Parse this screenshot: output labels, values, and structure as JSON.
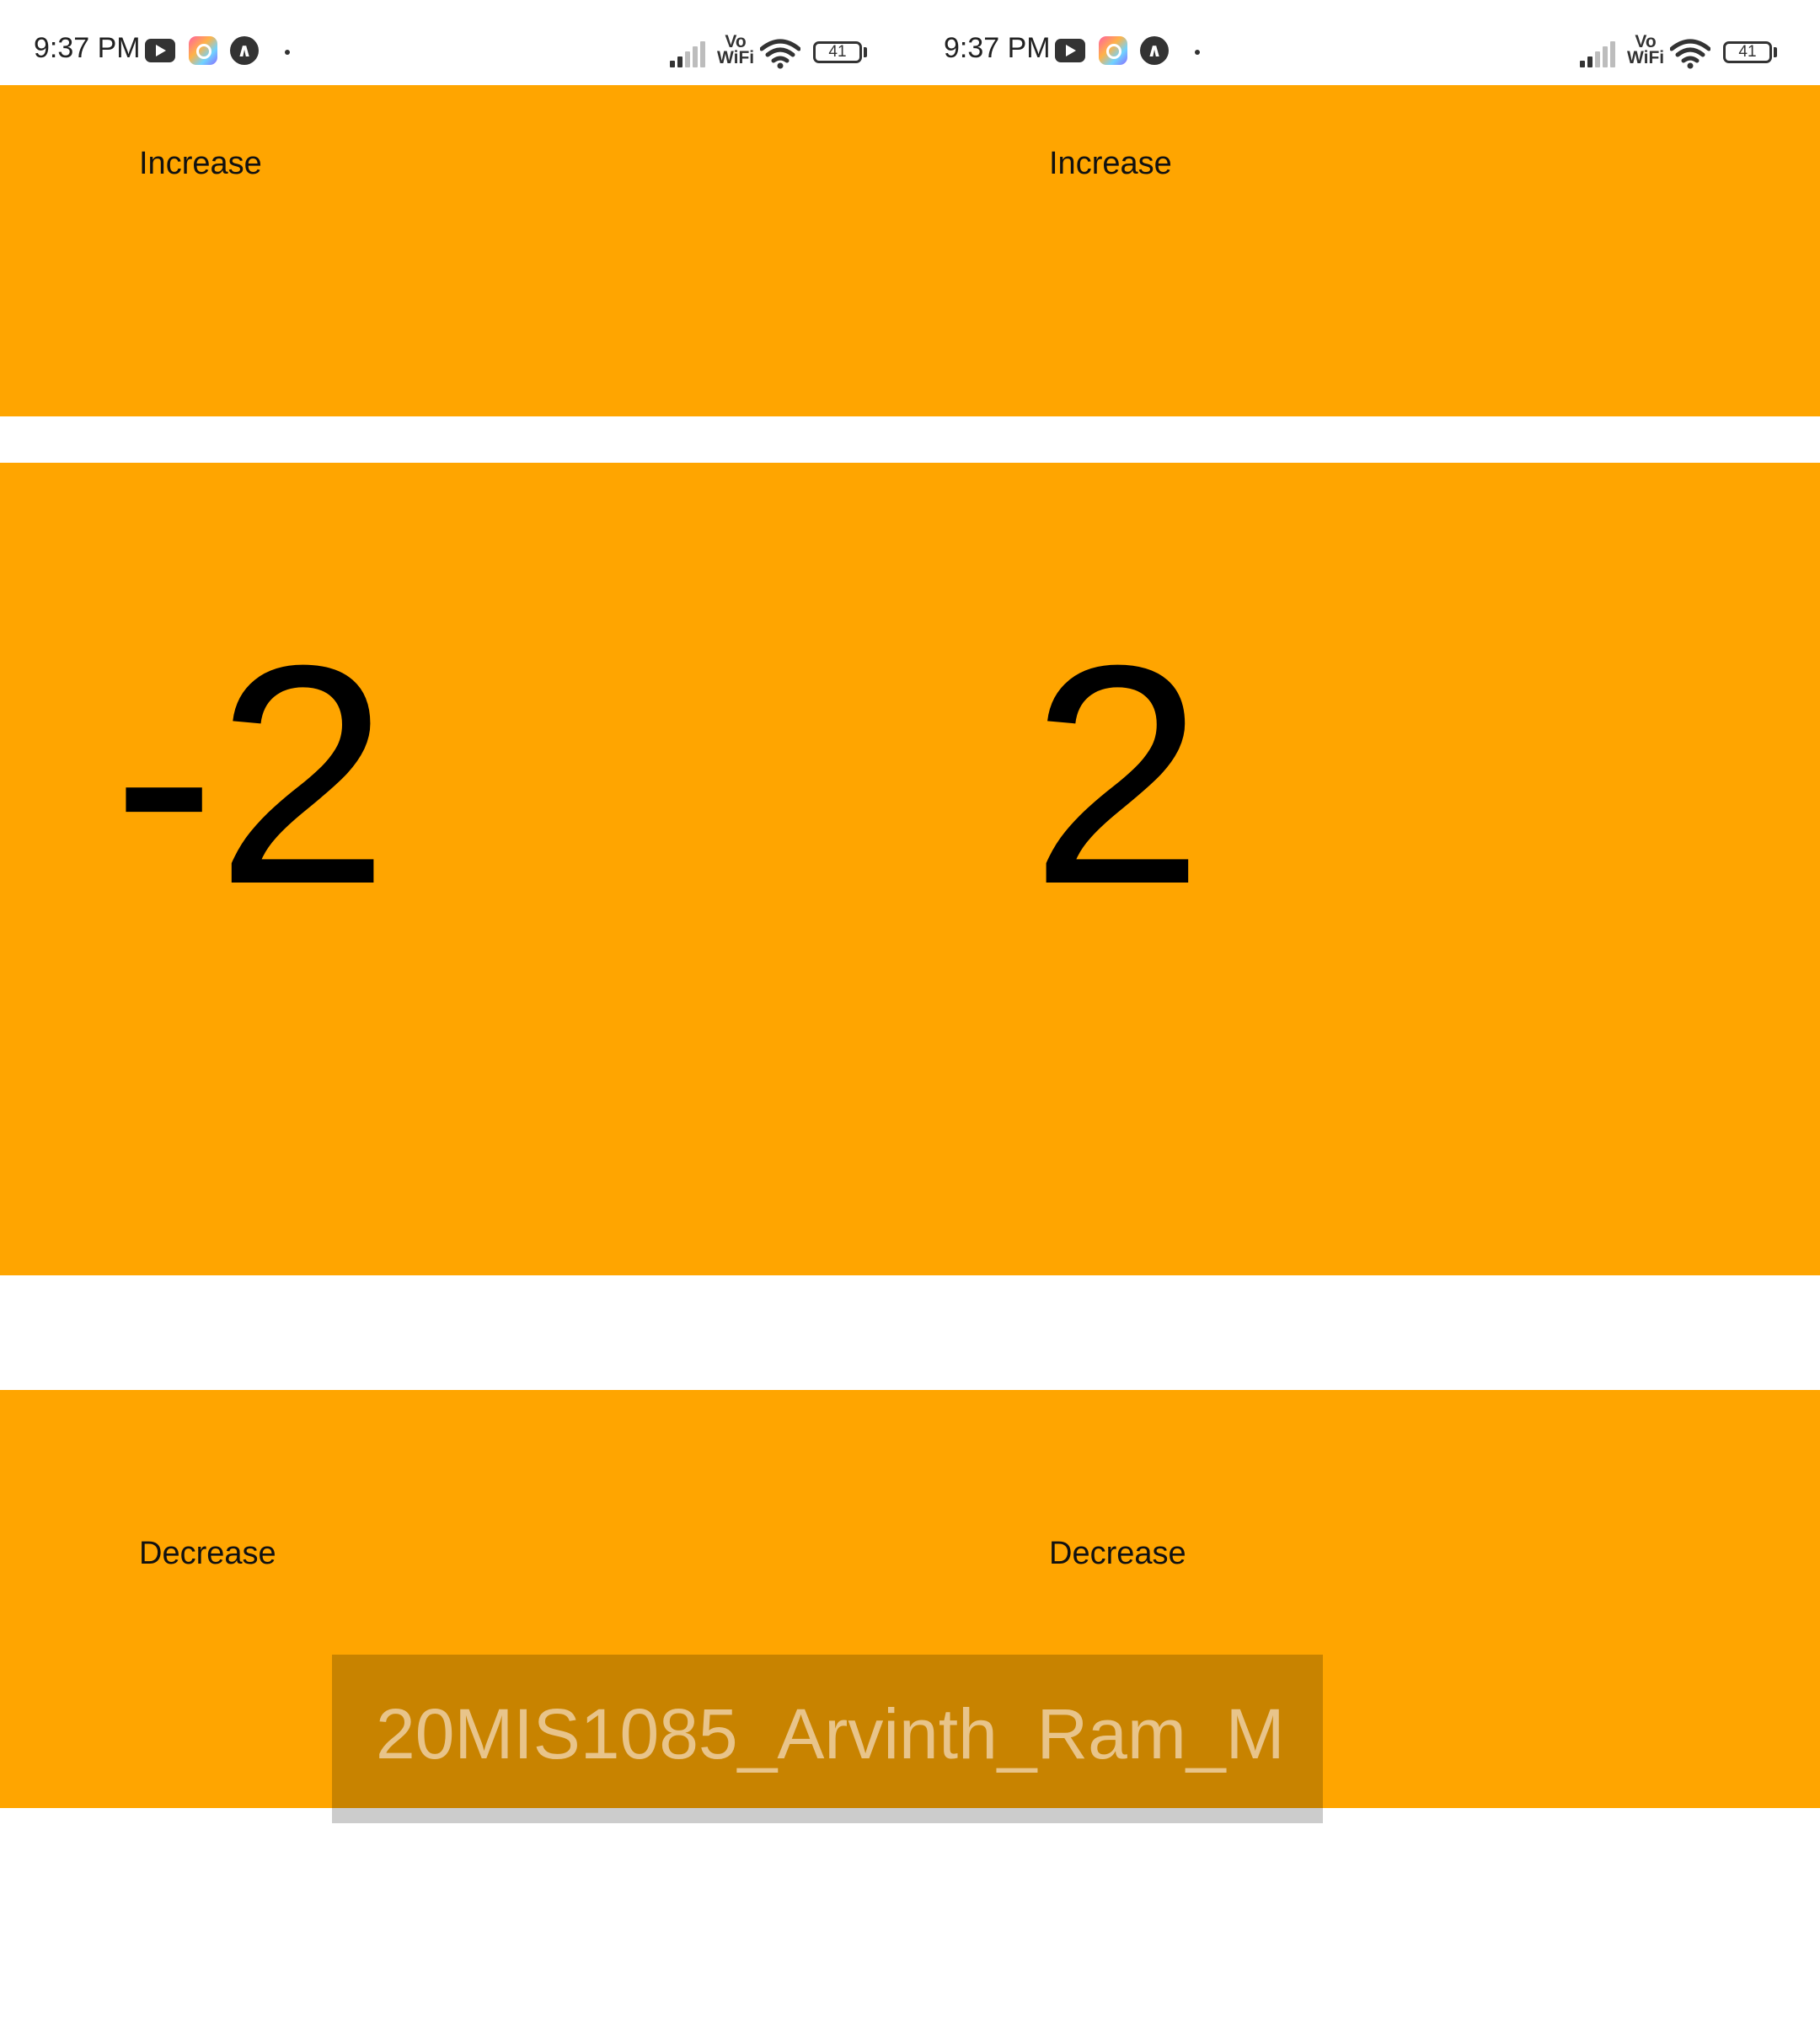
{
  "status_bar": {
    "left": {
      "time": "9:37 PM",
      "icons": [
        "youtube-icon",
        "q-app-icon",
        "a-app-icon",
        "notification-dot-icon"
      ],
      "vowifi_top": "Vo",
      "vowifi_bottom": "WiFi",
      "battery": "41"
    },
    "right": {
      "time": "9:37 PM",
      "icons": [
        "youtube-icon",
        "q-app-icon",
        "a-app-icon",
        "notification-dot-icon"
      ],
      "vowifi_top": "Vo",
      "vowifi_bottom": "WiFi",
      "battery": "41"
    }
  },
  "left_pane": {
    "increase_label": "Increase",
    "counter_value": "-2",
    "decrease_label": "Decrease"
  },
  "right_pane": {
    "increase_label": "Increase",
    "counter_value": "2",
    "decrease_label": "Decrease"
  },
  "watermark": {
    "text": "20MIS1085_Arvinth_Ram_M"
  },
  "colors": {
    "panel": "#FFA500",
    "watermark_bg": "#C88300",
    "watermark_text": "#E8C48A",
    "background": "#FFFFFF"
  }
}
